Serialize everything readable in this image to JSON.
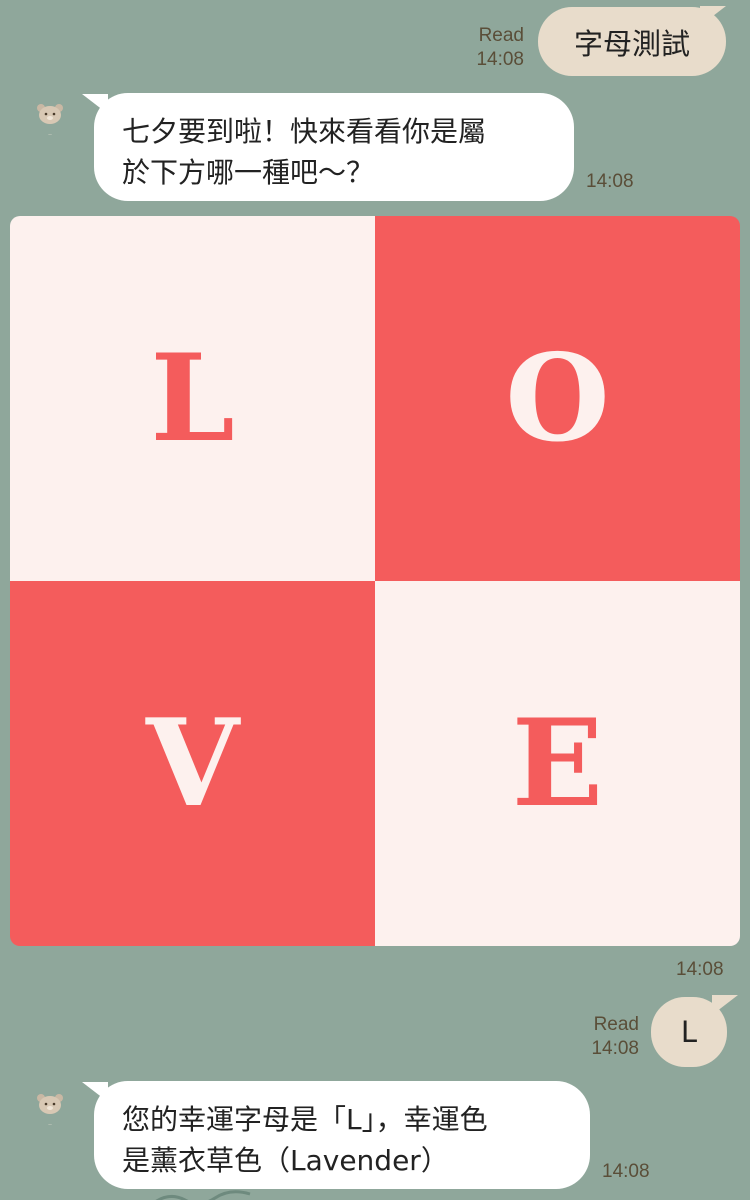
{
  "colors": {
    "background": "#8FA79B",
    "outgoing_bubble": "#E8DCCB",
    "incoming_bubble": "#FFFFFF",
    "card_red": "#F45C5C",
    "card_cream": "#FDF1EE"
  },
  "messages": [
    {
      "id": "m1",
      "direction": "out",
      "text": "字母測試",
      "status": "Read",
      "time": "14:08"
    },
    {
      "id": "m2",
      "direction": "in",
      "avatar": "bear-avatar",
      "lines": [
        "七夕要到啦！快來看看你是屬",
        "於下方哪一種吧～？"
      ],
      "time": "14:08"
    },
    {
      "id": "m3",
      "direction": "in",
      "type": "image",
      "tiles": [
        "L",
        "O",
        "V",
        "E"
      ],
      "time": "14:08"
    },
    {
      "id": "m4",
      "direction": "out",
      "text": "L",
      "status": "Read",
      "time": "14:08"
    },
    {
      "id": "m5",
      "direction": "in",
      "avatar": "bear-avatar",
      "lines": [
        "您的幸運字母是「L」，幸運色",
        "是薰衣草色（Lavender）"
      ],
      "time": "14:08"
    }
  ]
}
